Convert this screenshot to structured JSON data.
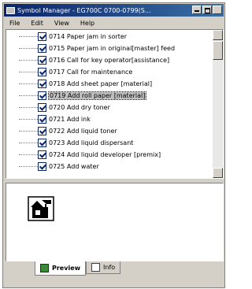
{
  "window": {
    "title": "Symbol Manager - EG700C  0700-0799(S..."
  },
  "menu": [
    {
      "label": "File"
    },
    {
      "label": "Edit"
    },
    {
      "label": "View"
    },
    {
      "label": "Help"
    }
  ],
  "tree_items": [
    {
      "label": "0714 Paper jam in sorter"
    },
    {
      "label": "0715 Paper jam in original[master] feed"
    },
    {
      "label": "0716 Call for key operator[assistance]"
    },
    {
      "label": "0717 Call for maintenance"
    },
    {
      "label": "0718 Add sheet paper [material]"
    },
    {
      "label": "0719 Add roll paper [material]",
      "selected": true
    },
    {
      "label": "0720 Add dry toner"
    },
    {
      "label": "0721 Add ink"
    },
    {
      "label": "0722 Add liquid toner"
    },
    {
      "label": "0723 Add liquid dispersant"
    },
    {
      "label": "0724 Add liquid developer [premix]"
    },
    {
      "label": "0725 Add water"
    }
  ],
  "tabs": [
    {
      "label": "Preview",
      "icon": "preview-icon"
    },
    {
      "label": "Info",
      "icon": "info-icon"
    }
  ],
  "colors": {
    "title_bar": "#0a246a",
    "window": "#d4d0c8",
    "check": "#0a246a"
  }
}
